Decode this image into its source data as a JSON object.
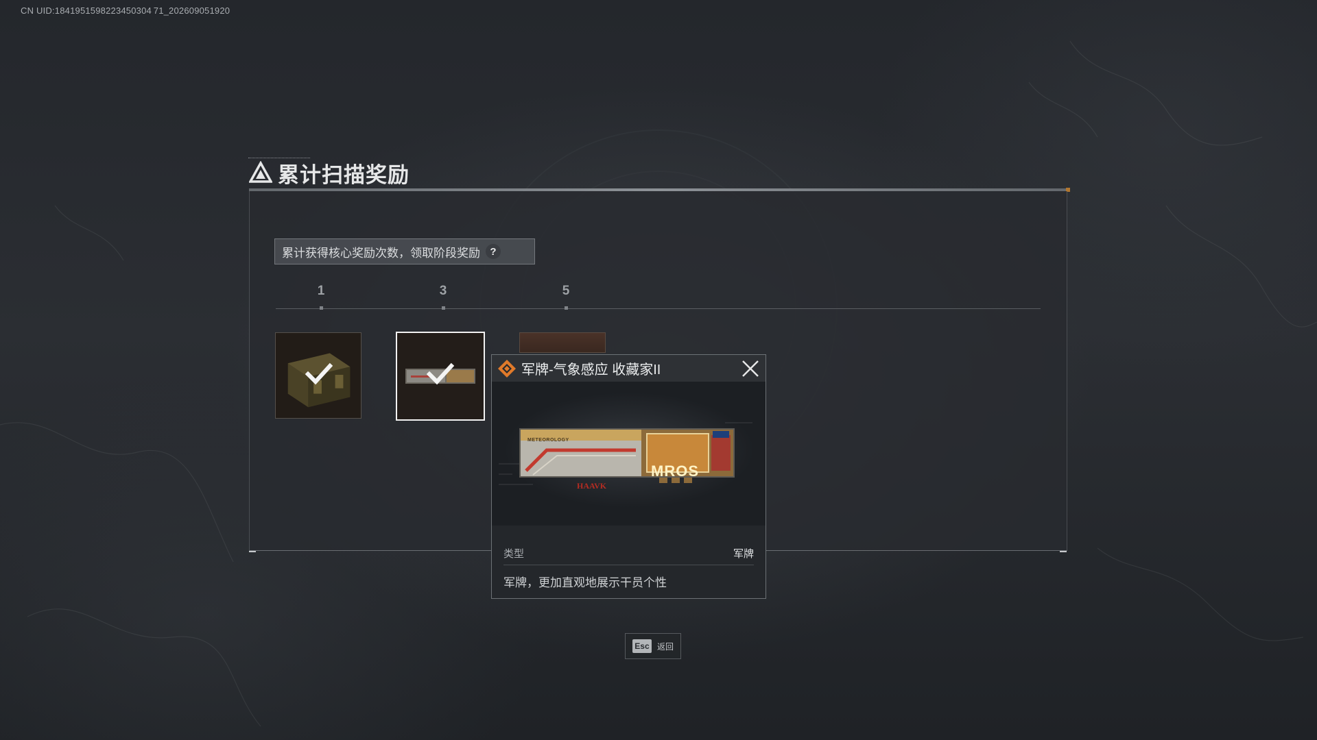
{
  "uid_text": "CN UID:1841951598223450304 71_202609051920",
  "panel": {
    "title": "累计扫描奖励",
    "info_text": "累计获得核心奖励次数，领取阶段奖励",
    "help_glyph": "?"
  },
  "milestones": [
    "1",
    "3",
    "5"
  ],
  "rewards": [
    {
      "milestone": "1",
      "item": "supply-crate",
      "claimed": true
    },
    {
      "milestone": "3",
      "item": "dog-tag",
      "claimed": true,
      "selected": true
    },
    {
      "milestone": "5",
      "item": "locked",
      "claimed": false
    }
  ],
  "popup": {
    "title": "军牌-气象感应 收藏家II",
    "type_label": "类型",
    "type_value": "军牌",
    "description": "军牌，更加直观地展示干员个性",
    "tag_art_text": {
      "left_top": "METEOROLOGY",
      "left_brand": "HAAVK",
      "right_logo": "MROS"
    }
  },
  "footer": {
    "esc_key": "Esc",
    "esc_label": "返回"
  },
  "colors": {
    "accent_orange": "#e07a2a",
    "panel_bg": "#282b30",
    "text_primary": "#e6e7e8"
  }
}
